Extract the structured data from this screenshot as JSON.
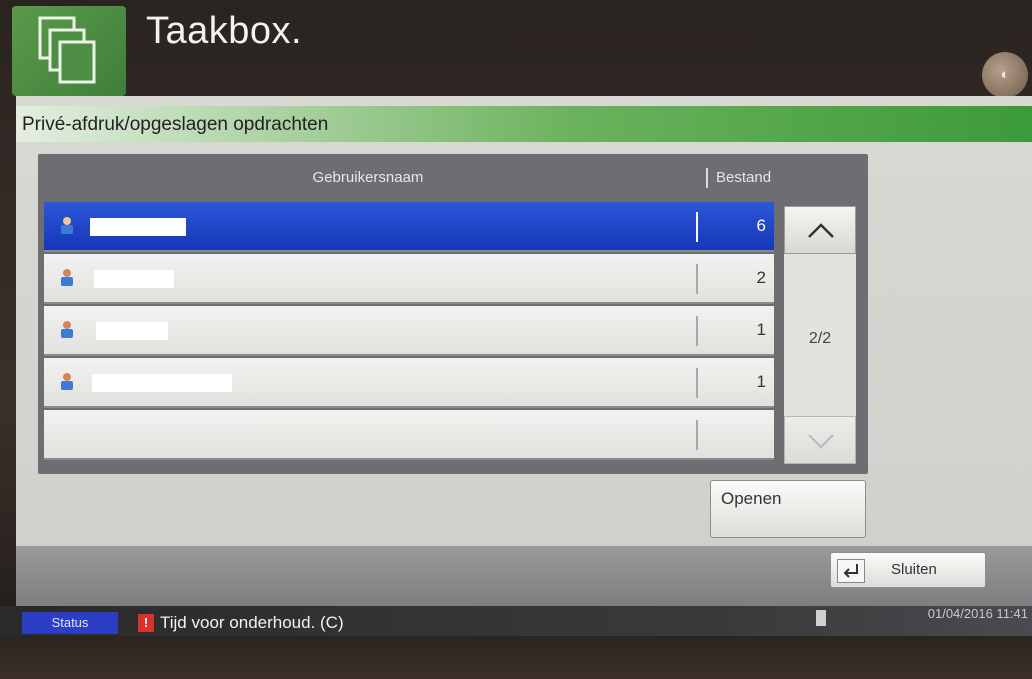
{
  "header": {
    "title": "Taakbox.",
    "icon": "folders-icon"
  },
  "panel": {
    "title": "Privé-afdruk/opgeslagen opdrachten"
  },
  "table": {
    "col_user": "Gebruikersnaam",
    "col_file": "Bestand",
    "rows": [
      {
        "count": "6",
        "selected": true
      },
      {
        "count": "2",
        "selected": false
      },
      {
        "count": "1",
        "selected": false
      },
      {
        "count": "1",
        "selected": false
      }
    ]
  },
  "pager": {
    "indicator": "2/2",
    "up_icon": "chevron-up-icon",
    "down_icon": "chevron-down-icon"
  },
  "actions": {
    "open_label": "Openen",
    "close_label": "Sluiten",
    "close_icon": "enter-icon"
  },
  "statusbar": {
    "status_label": "Status",
    "warning_icon": "warning-icon",
    "message": "Tijd voor onderhoud. (C)",
    "datetime": "01/04/2016 11:41"
  },
  "colors": {
    "accent_green": "#3c9a3a",
    "selection_blue": "#1f44c8",
    "status_blue": "#2b3ec4",
    "warning_red": "#d8322c"
  }
}
